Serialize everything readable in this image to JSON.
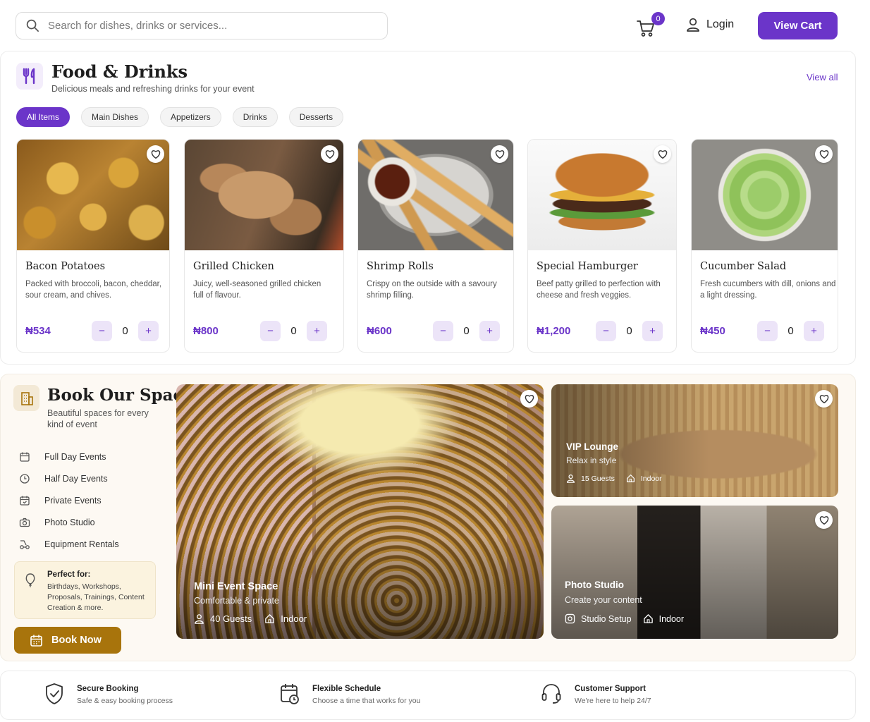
{
  "search": {
    "placeholder": "Search for dishes, drinks or services..."
  },
  "cart": {
    "count": "0",
    "view_cart_label": "View Cart"
  },
  "login": {
    "label": "Login"
  },
  "food": {
    "title": "Food & Drinks",
    "subtitle": "Delicious meals and refreshing drinks for your event",
    "view_all": "View all",
    "filters": [
      "All Items",
      "Main Dishes",
      "Appetizers",
      "Drinks",
      "Desserts"
    ],
    "items": [
      {
        "name": "Bacon Potatoes",
        "description": "Packed with broccoli, bacon, cheddar, sour cream, and chives.",
        "price": "₦534",
        "qty": "0"
      },
      {
        "name": "Grilled Chicken",
        "description": "Juicy, well-seasoned grilled chicken full of flavour.",
        "price": "₦800",
        "qty": "0"
      },
      {
        "name": "Shrimp Rolls",
        "description": "Crispy on the outside with a savoury shrimp filling.",
        "price": "₦600",
        "qty": "0"
      },
      {
        "name": "Special Hamburger",
        "description": "Beef patty grilled to perfection with cheese and fresh veggies.",
        "price": "₦1,200",
        "qty": "0"
      },
      {
        "name": "Cucumber Salad",
        "description": "Fresh cucumbers with dill, onions and a light dressing.",
        "price": "₦450",
        "qty": "0"
      }
    ],
    "minus": "−",
    "plus": "+"
  },
  "space": {
    "title": "Book Our Space",
    "subtitle": "Beautiful spaces for every kind of event",
    "categories": [
      "Full Day Events",
      "Half Day Events",
      "Private Events",
      "Photo Studio",
      "Equipment Rentals"
    ],
    "perfect_title": "Perfect for:",
    "perfect_text": "Birthdays, Workshops, Proposals, Trainings, Content Creation & more.",
    "book_now": "Book Now",
    "venues": [
      {
        "name": "Mini Event Space",
        "subtitle": "Comfortable & private",
        "meta1": "40 Guests",
        "meta2": "Indoor"
      },
      {
        "name": "VIP Lounge",
        "subtitle": "Relax in style",
        "meta1": "15 Guests",
        "meta2": "Indoor"
      },
      {
        "name": "Photo Studio",
        "subtitle": "Create your content",
        "meta1": "Studio Setup",
        "meta2": "Indoor"
      }
    ]
  },
  "features": [
    {
      "title": "Secure Booking",
      "description": "Safe & easy booking process"
    },
    {
      "title": "Flexible Schedule",
      "description": "Choose a time that works for you"
    },
    {
      "title": "Customer Support",
      "description": "We're here to help 24/7"
    }
  ],
  "colors": {
    "accent": "#6b35c9",
    "gold": "#a8740c"
  }
}
